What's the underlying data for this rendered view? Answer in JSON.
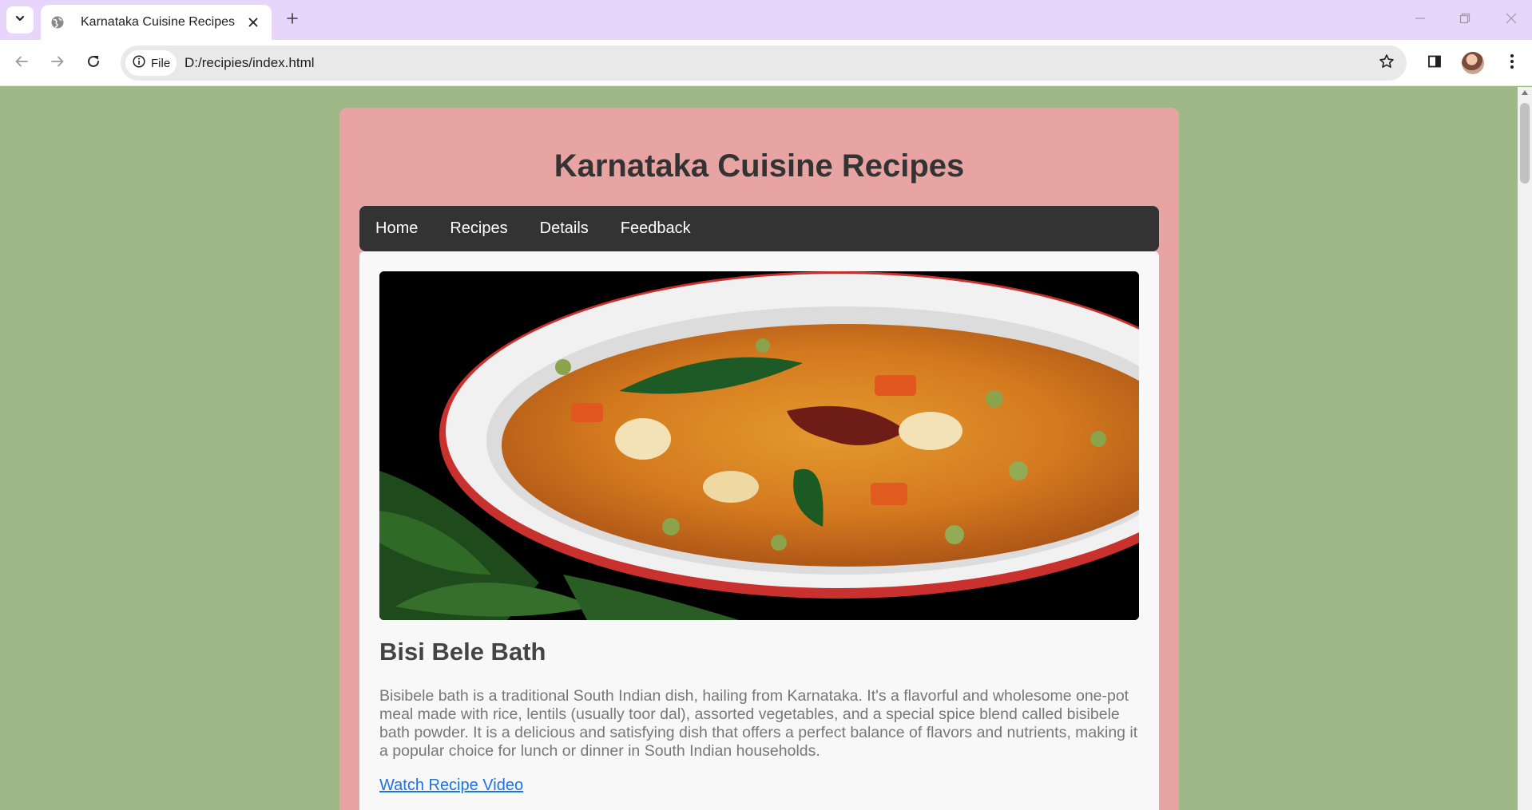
{
  "browser": {
    "tab_title": "Karnataka Cuisine Recipes",
    "address_chip": "File",
    "url": "D:/recipies/index.html"
  },
  "page": {
    "title": "Karnataka Cuisine Recipes",
    "nav": [
      "Home",
      "Recipes",
      "Details",
      "Feedback"
    ],
    "recipe": {
      "name": "Bisi Bele Bath",
      "description": "Bisibele bath is a traditional South Indian dish, hailing from Karnataka. It's a flavorful and wholesome one-pot meal made with rice, lentils (usually toor dal), assorted vegetables, and a special spice blend called bisibele bath powder. It is a delicious and satisfying dish that offers a perfect balance of flavors and nutrients, making it a popular choice for lunch or dinner in South Indian households.",
      "video_link": "Watch Recipe Video"
    }
  },
  "colors": {
    "page_bg": "#a0b887",
    "container_bg": "#e8a3a3",
    "nav_bg": "#333333",
    "link": "#1a73e8",
    "tab_strip": "#e8d5fb"
  },
  "icons": [
    "tab-search-icon",
    "globe-icon",
    "close-icon",
    "plus-icon",
    "minimize-icon",
    "restore-icon",
    "window-close-icon",
    "back-arrow-icon",
    "forward-arrow-icon",
    "reload-icon",
    "info-icon",
    "star-icon",
    "side-panel-icon",
    "kebab-menu-icon"
  ]
}
